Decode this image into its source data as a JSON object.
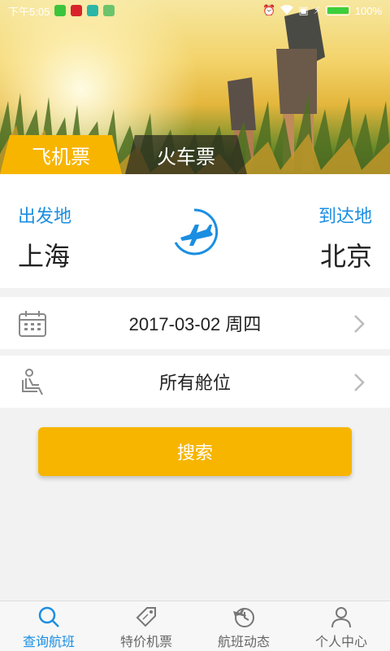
{
  "status_bar": {
    "time": "下午5:05",
    "battery": "100%"
  },
  "tabs": [
    {
      "label": "飞机票"
    },
    {
      "label": "火车票"
    }
  ],
  "route": {
    "from_label": "出发地",
    "from_city": "上海",
    "to_label": "到达地",
    "to_city": "北京"
  },
  "date_row": {
    "value": "2017-03-02 周四"
  },
  "cabin_row": {
    "value": "所有舱位"
  },
  "search": {
    "label": "搜索"
  },
  "bottom_nav": [
    {
      "label": "查询航班",
      "icon": "search-icon"
    },
    {
      "label": "特价机票",
      "icon": "tag-icon"
    },
    {
      "label": "航班动态",
      "icon": "flight-status-icon"
    },
    {
      "label": "个人中心",
      "icon": "person-icon"
    }
  ],
  "colors": {
    "accent": "#f7b500",
    "primary_blue": "#1a8ee2"
  }
}
